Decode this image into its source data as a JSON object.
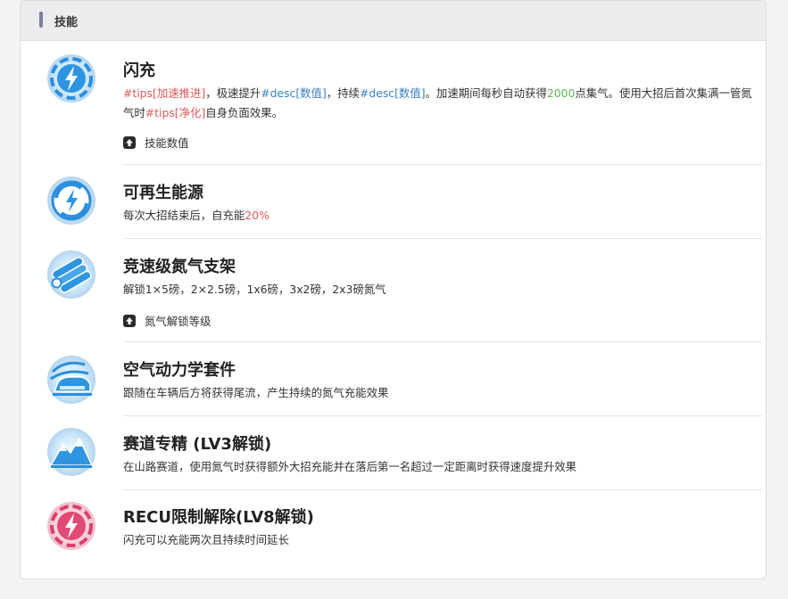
{
  "panel": {
    "title": "技能"
  },
  "skills": [
    {
      "name": "闪充",
      "icon": "lightning-cycle-icon",
      "desc": {
        "p1": "#tips[加速推进]",
        "p2": "，极速提升",
        "p3": "#desc[数值]",
        "p4": "，持续",
        "p5": "#desc[数值]",
        "p6": "。加速期间每秒自动获得",
        "p7": "2000",
        "p8": "点集气。使用大招后首次集满一管氮气时",
        "p9": "#tips[净化]",
        "p10": "自身负面效果。"
      },
      "expander": "技能数值"
    },
    {
      "name": "可再生能源",
      "icon": "renewable-lightning-icon",
      "desc": {
        "p1": "每次大招结束后，自充能",
        "p2": "20%"
      }
    },
    {
      "name": "竞速级氮气支架",
      "icon": "nitro-tanks-icon",
      "desc": {
        "p1": "解锁1×5磅，2×2.5磅，1x6磅，3x2磅，2x3磅氮气"
      },
      "expander": "氮气解锁等级"
    },
    {
      "name": "空气动力学套件",
      "icon": "aero-car-icon",
      "desc": {
        "p1": "跟随在车辆后方将获得尾流，产生持续的氮气充能效果"
      }
    },
    {
      "name": "赛道专精 (LV3解锁)",
      "icon": "mountain-icon",
      "desc": {
        "p1": "在山路赛道，使用氮气时获得额外大招充能并在落后第一名超过一定距离时获得速度提升效果"
      }
    },
    {
      "name": "RECU限制解除(LV8解锁)",
      "icon": "red-lightning-icon",
      "desc": {
        "p1": "闪充可以充能两次且持续时间延长"
      }
    }
  ],
  "colors": {
    "tips": "#e05a5a",
    "desc": "#3b7fc0",
    "green_value": "#5cb85c",
    "icon_blue": "#3a9be0",
    "icon_red": "#d8406a"
  }
}
